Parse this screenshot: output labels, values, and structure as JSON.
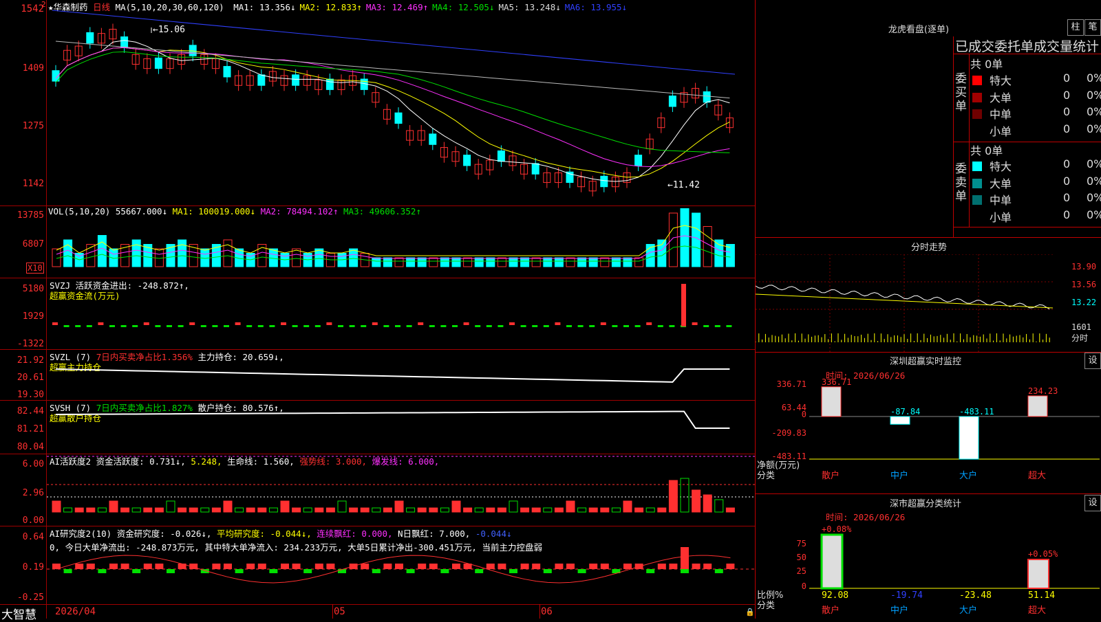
{
  "main": {
    "stock_name": "★华森制药",
    "period": "日线",
    "ma_header": "MA(5,10,20,30,60,120)",
    "ma_values": [
      {
        "label": "MA1:",
        "value": "13.356↓",
        "color": "#ffffff"
      },
      {
        "label": "MA2:",
        "value": "12.833↑",
        "color": "#ffff00"
      },
      {
        "label": "MA3:",
        "value": "12.469↑",
        "color": "#ff30ff"
      },
      {
        "label": "MA4:",
        "value": "12.505↓",
        "color": "#00e000"
      },
      {
        "label": "MA5:",
        "value": "13.248↓",
        "color": "#dddddd"
      },
      {
        "label": "MA6:",
        "value": "13.955↓",
        "color": "#3040ff"
      }
    ],
    "y_ticks": [
      "1542",
      "1409",
      "1275",
      "1142"
    ],
    "high_label": "15.06",
    "low_label": "11.42"
  },
  "vol": {
    "header": "VOL(5,10,20)",
    "value": "55667.000↓",
    "ma1": "MA1: 100019.000↓",
    "ma2": "MA2: 78494.102↑",
    "ma3": "MA3: 49606.352↑",
    "y_ticks": [
      "13785",
      "6807"
    ],
    "unit": "X10"
  },
  "svzj": {
    "header": "SVZJ  活跃资金进出: -248.872↑,",
    "subtitle": "超赢资金流(万元)",
    "y_ticks": [
      "5180",
      "1929",
      "-1322"
    ]
  },
  "svzl": {
    "header": "SVZL (7)",
    "ratio": "7日内买卖净占比1.356%",
    "hold": "主力持仓: 20.659↓,",
    "subtitle": "超赢主力持仓",
    "y_ticks": [
      "21.92",
      "20.61",
      "19.30"
    ]
  },
  "svsh": {
    "header": "SVSH (7)",
    "ratio": "7日内买卖净占比1.827%",
    "hold": "散户持仓: 80.576↑,",
    "subtitle": "超赢散户持仓",
    "y_ticks": [
      "82.44",
      "81.21",
      "80.04"
    ]
  },
  "ai1": {
    "header": "AI活跃度2 资金活跃度: 0.731↓,",
    "v2": "5.248,",
    "life": "生命线: 1.560,",
    "strong": "强势线: 3.000,",
    "burst": "爆发线: 6.000,",
    "y_ticks": [
      "6.00",
      "2.96",
      "0.00"
    ]
  },
  "ai2": {
    "header": "AI研究度2(10) 资金研究度: -0.026↓,",
    "avg": "平均研究度: -0.044↓,",
    "red": "连续飘红: 0.000,",
    "nred": "N日飘红: 7.000,",
    "last": "-0.044↓",
    "summary": "0, 今日大单净流出: -248.873万元, 其中特大单净流入: 234.233万元, 大单5日累计净出-300.451万元, 当前主力控盘弱",
    "y_ticks": [
      "0.64",
      "0.19",
      "-0.25"
    ]
  },
  "bottom": {
    "logo": "大智慧",
    "dates": [
      "2026/04",
      "05",
      "06"
    ]
  },
  "right": {
    "dragon_title": "龙虎看盘(逐单)",
    "btn_zhu": "柱",
    "btn_bi": "笔",
    "order_title": "已成交委托单成交量统计",
    "buy_label": "委买单",
    "sell_label": "委卖单",
    "buy_total": "共 0单",
    "sell_total": "共 0单",
    "buy_rows": [
      {
        "name": "特大",
        "count": "0",
        "pct": "0%",
        "color": "#ff0000"
      },
      {
        "name": "大单",
        "count": "0",
        "pct": "0%",
        "color": "#a00000"
      },
      {
        "name": "中单",
        "count": "0",
        "pct": "0%",
        "color": "#700000"
      },
      {
        "name": "小单",
        "count": "0",
        "pct": "0%",
        "color": "#000000"
      }
    ],
    "sell_rows": [
      {
        "name": "特大",
        "count": "0",
        "pct": "0%",
        "color": "#00ffff"
      },
      {
        "name": "大单",
        "count": "0",
        "pct": "0%",
        "color": "#009090"
      },
      {
        "name": "中单",
        "count": "0",
        "pct": "0%",
        "color": "#007070"
      },
      {
        "name": "小单",
        "count": "0",
        "pct": "0%",
        "color": "#000000"
      }
    ],
    "fenshi_title": "分时走势",
    "fenshi_ticks": [
      "13.90",
      "13.56",
      "13.22",
      "1601",
      "分时"
    ],
    "sz_title": "深圳超赢实时监控",
    "sz_btn": "设",
    "sz_time": "时间: 2026/06/26",
    "sz_ticks": [
      "336.71",
      "63.44",
      "0",
      "-209.83",
      "-483.11"
    ],
    "sz_bars": [
      {
        "label": "散户",
        "value": "336.71"
      },
      {
        "label": "中户",
        "value": "-87.84"
      },
      {
        "label": "大户",
        "value": "-483.11"
      },
      {
        "label": "超大",
        "value": "234.23"
      }
    ],
    "sz_axis1": "净额(万元)",
    "sz_axis2": "分类",
    "sc_title": "深市超赢分类统计",
    "sc_btn": "设",
    "sc_time": "时间: 2026/06/26",
    "sc_ticks": [
      "75",
      "50",
      "25",
      "0"
    ],
    "sc_top": [
      "+0.08%",
      "+0.05%"
    ],
    "sc_bars": [
      {
        "label": "散户",
        "value": "92.08"
      },
      {
        "label": "中户",
        "value": "-19.74"
      },
      {
        "label": "大户",
        "value": "-23.48"
      },
      {
        "label": "超大",
        "value": "51.14"
      }
    ],
    "sc_axis1": "比例%",
    "sc_axis2": "分类"
  }
}
